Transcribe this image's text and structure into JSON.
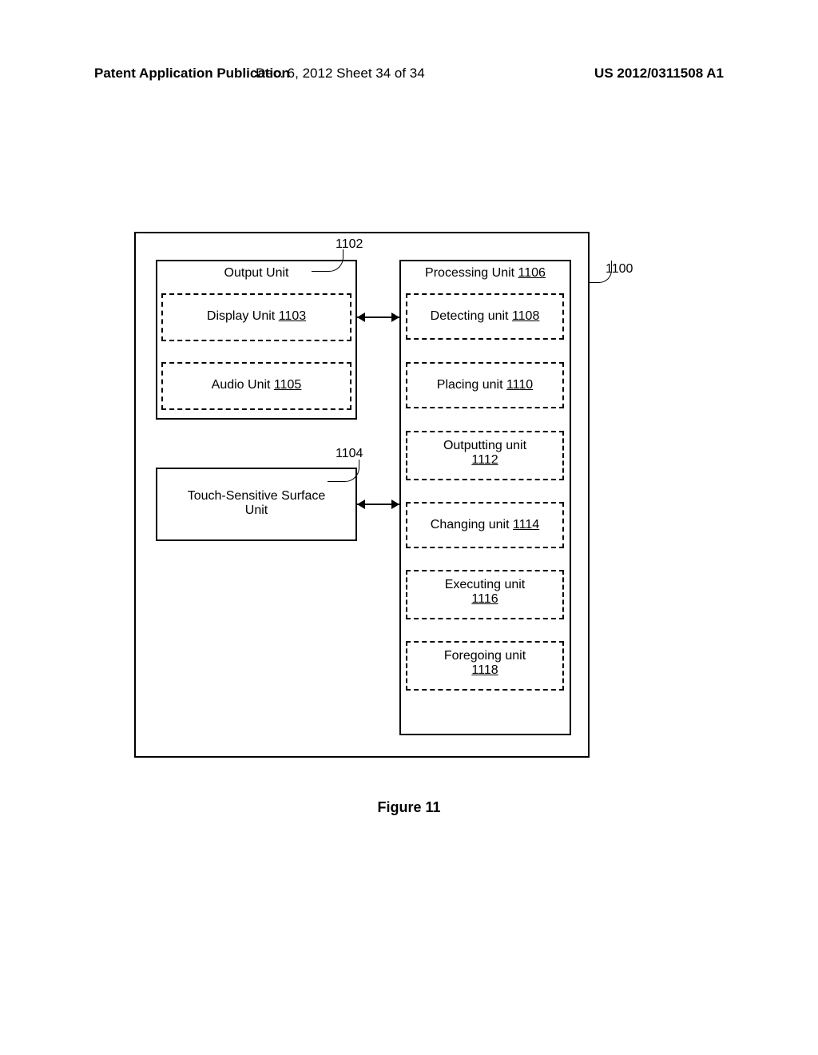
{
  "header": {
    "left": "Patent Application Publication",
    "center": "Dec. 6, 2012  Sheet 34 of 34",
    "right": "US 2012/0311508 A1"
  },
  "refs": {
    "r1100": "1100",
    "r1102": "1102",
    "r1104": "1104"
  },
  "output_unit": {
    "title": "Output Unit",
    "display_label": "Display Unit ",
    "display_num": "1103",
    "audio_label": "Audio Unit ",
    "audio_num": "1105"
  },
  "touch_unit": {
    "line1": "Touch-Sensitive Surface",
    "line2": "Unit"
  },
  "processing_unit": {
    "title": "Processing Unit ",
    "title_num": "1106",
    "detecting_label": "Detecting unit ",
    "detecting_num": "1108",
    "placing_label": "Placing unit ",
    "placing_num": "1110",
    "outputting_label": "Outputting unit",
    "outputting_num": "1112",
    "changing_label": "Changing unit ",
    "changing_num": "1114",
    "executing_label": "Executing unit",
    "executing_num": "1116",
    "foregoing_label": "Foregoing unit",
    "foregoing_num": "1118"
  },
  "caption": "Figure 11"
}
